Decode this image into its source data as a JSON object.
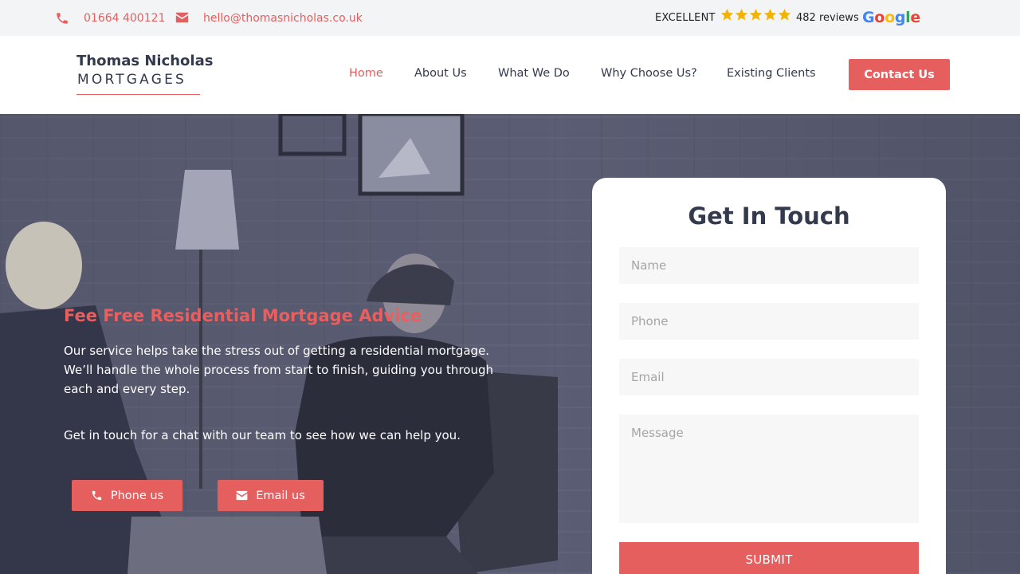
{
  "topbar": {
    "phone": "01664 400121",
    "email": "hello@thomasnicholas.co.uk",
    "rating_label": "EXCELLENT",
    "stars": 5,
    "reviews": "482 reviews",
    "google_logo": "Google"
  },
  "header": {
    "logo_line1": "Thomas Nicholas",
    "logo_line2": "MORTGAGES",
    "nav": {
      "home": "Home",
      "about": "About Us",
      "what": "What We Do",
      "why": "Why Choose Us?",
      "existing": "Existing Clients"
    },
    "contact_label": "Contact Us"
  },
  "hero": {
    "heading": "Fee Free Residential Mortgage Advice",
    "body": "Our service helps take the stress out of getting a residential mortgage. We’ll handle the whole process from start to finish, guiding you through each and every step.",
    "cta": "Get in touch for a chat with our team to see how we can help you.",
    "phone_button": "Phone us",
    "email_button": "Email us"
  },
  "form": {
    "title": "Get In Touch",
    "name_placeholder": "Name",
    "phone_placeholder": "Phone",
    "email_placeholder": "Email",
    "message_placeholder": "Message",
    "submit_label": "SUBMIT"
  },
  "colors": {
    "accent": "#e55f5f",
    "dark_text": "#333a4d",
    "star": "#f5b301"
  },
  "icons": {
    "phone": "phone-icon",
    "email": "envelope-icon",
    "star": "star-icon"
  }
}
